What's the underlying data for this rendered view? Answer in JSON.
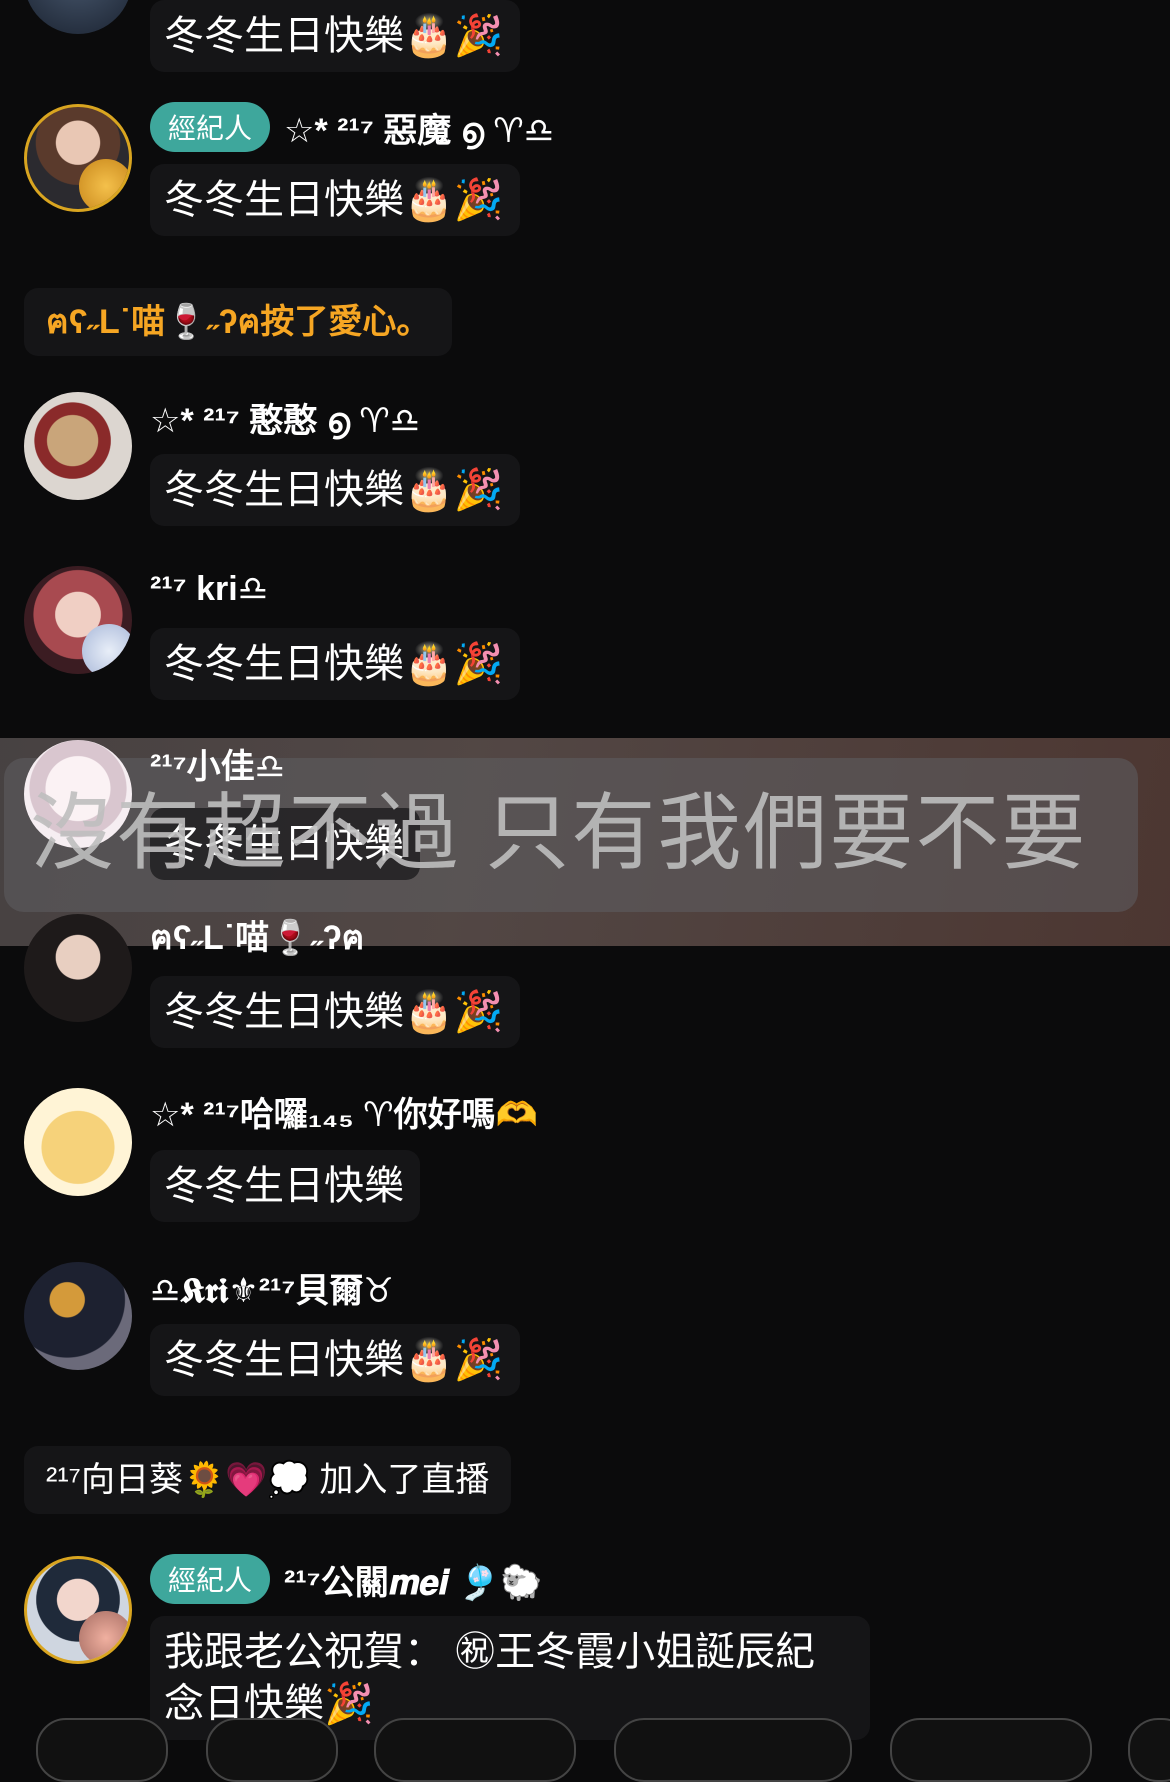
{
  "colors": {
    "background": "#0b0b0c",
    "bubble": "#151517",
    "role_badge": "#3ea79c",
    "system_orange": "#f6a623",
    "zodiac_purple": "#9b3fcf",
    "blessing_red": "#d32020"
  },
  "messages": [
    {
      "text": "冬冬生日快樂🎂🎉"
    },
    {
      "role": "經紀人",
      "name": "☆* ²¹⁷ 惡魔 ൭ ♈︎♎",
      "text": "冬冬生日快樂🎂🎉"
    },
    {
      "system": "ฅʕ˶L˙喵🍷˶ʔฅ按了愛心。"
    },
    {
      "name": "☆* ²¹⁷ 憨憨 ൭ ♈︎♎",
      "text": "冬冬生日快樂🎂🎉"
    },
    {
      "name": "²¹⁷ kri♎",
      "text": "冬冬生日快樂🎂🎉"
    },
    {
      "name": "²¹⁷小佳♎",
      "text": "冬冬生日快樂"
    },
    {
      "name": "ฅʕ˶L˙喵🍷˶ʔฅ",
      "text": "冬冬生日快樂🎂🎉"
    },
    {
      "name": "☆* ²¹⁷哈囉₁₄₅ ♈︎你好嗎🫶",
      "text": "冬冬生日快樂"
    },
    {
      "name": "♎𝕶𝖗𝖎⚜²¹⁷貝爾♉",
      "text": "冬冬生日快樂🎂🎉"
    },
    {
      "system": "²¹⁷向日葵🌻💗💭 加入了直播"
    },
    {
      "role": "經紀人",
      "name": "²¹⁷公關𝒎𝒆𝒊 🎐🐑",
      "text_line1": "我跟老公祝賀： ㊗王冬霞小姐誕辰紀",
      "text_line2": "念日快樂🎉"
    }
  ],
  "lyric": "沒有超不過 只有我們要不要"
}
